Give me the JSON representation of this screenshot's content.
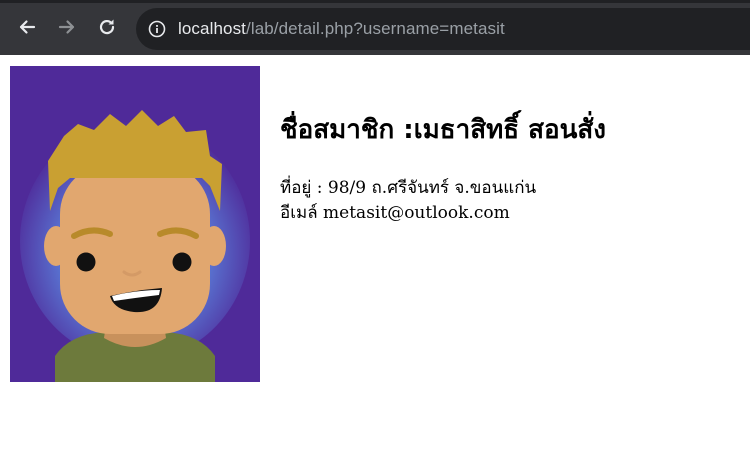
{
  "browser": {
    "url_host": "localhost",
    "url_path": "/lab/detail.php?username=metasit",
    "icons": {
      "back": "arrow-left-icon",
      "forward": "arrow-right-icon",
      "reload": "reload-icon",
      "site_info": "info-circle-icon"
    }
  },
  "profile": {
    "title": "ชื่อสมาชิก :เมธาสิทธิ์ สอนสั่ง",
    "address_line": "ที่อยู่ : 98/9 ถ.ศรีจันทร์ จ.ขอนแก่น",
    "email_line": "อีเมล์ metasit@outlook.com"
  },
  "colors": {
    "chrome_bar": "#35363a",
    "omnibox": "#202124",
    "avatar_background": "#4f2a99",
    "avatar_glow": "#5a7ad6",
    "hair": "#c9a032",
    "skin": "#e1a76f",
    "shirt": "#6d7a3c"
  }
}
